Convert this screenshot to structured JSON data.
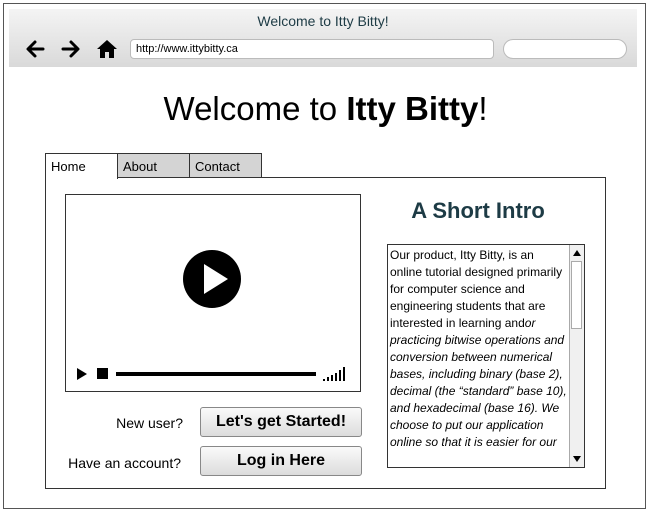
{
  "browser": {
    "title": "Welcome to Itty Bitty!",
    "url": "http://www.ittybitty.ca",
    "back_icon": "left-arrow-icon",
    "forward_icon": "right-arrow-icon",
    "home_icon": "home-icon"
  },
  "page": {
    "heading_prefix": "Welcome to ",
    "heading_brand": "Itty Bitty",
    "heading_suffix": "!"
  },
  "tabs": [
    {
      "label": "Home",
      "active": true
    },
    {
      "label": "About",
      "active": false
    },
    {
      "label": "Contact",
      "active": false
    }
  ],
  "intro": {
    "title": "A Short Intro",
    "text_plain": "Our product, Itty Bitty, is an online tutorial designed primarily for computer science and engineering students that are interested in learning and",
    "text_italic": "or practicing bitwise operations and conversion between numerical bases, including binary (base 2), decimal (the “standard” base 10), and hexadecimal (base 16). We choose to put our application online so that it is easier for our"
  },
  "actions": {
    "new_user_label": "New user?",
    "start_button": "Let's get Started!",
    "account_label": "Have an account?",
    "login_button": "Log in Here"
  },
  "video": {
    "big_play_icon": "play-circle-icon",
    "play_icon": "play-icon",
    "stop_icon": "stop-icon",
    "volume_icon": "volume-bars-icon"
  },
  "colors": {
    "accent": "#1d3b45",
    "tab_inactive": "#d4d4d4"
  }
}
